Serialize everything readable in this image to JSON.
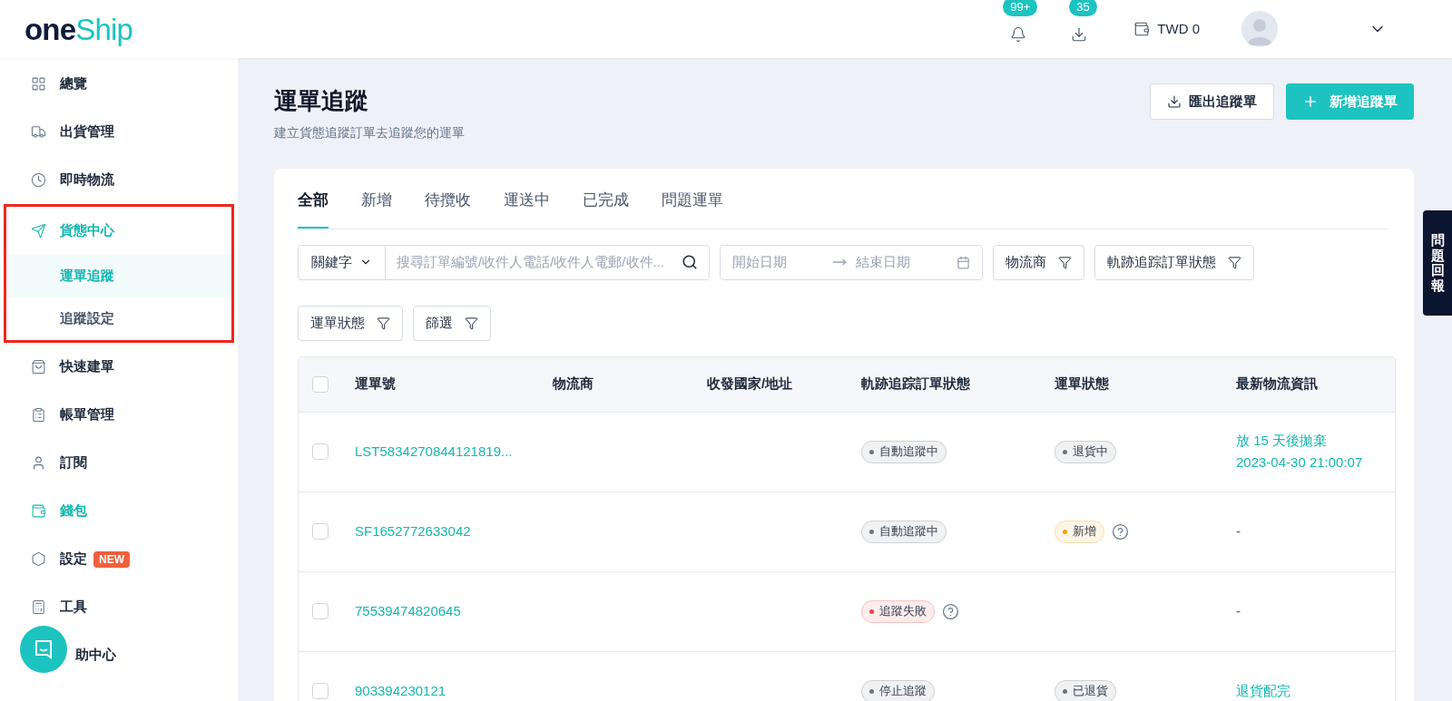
{
  "header": {
    "logo": {
      "dark": "one",
      "teal": "Ship"
    },
    "notifications": "99+",
    "downloads": "35",
    "wallet": "TWD 0"
  },
  "sidebar": {
    "items": [
      {
        "label": "總覽",
        "active": false
      },
      {
        "label": "出貨管理",
        "active": false
      },
      {
        "label": "即時物流",
        "active": false
      },
      {
        "label": "貨態中心",
        "active": true,
        "expanded": true,
        "annotated": true,
        "children": [
          {
            "label": "運單追蹤",
            "selected": true
          },
          {
            "label": "追蹤設定",
            "selected": false
          }
        ]
      },
      {
        "label": "快速建單",
        "active": false
      },
      {
        "label": "帳單管理",
        "active": false
      },
      {
        "label": "訂閱",
        "active": false
      },
      {
        "label": "錢包",
        "active": true
      },
      {
        "label": "設定",
        "active": false,
        "badge": "NEW"
      },
      {
        "label": "工具",
        "active": false
      },
      {
        "label": "助中心",
        "active": false
      }
    ]
  },
  "page": {
    "title": "運單追蹤",
    "subtitle": "建立貨態追蹤訂單去追蹤您的運單",
    "buttons": [
      {
        "label": "匯出追蹤單",
        "kind": "outline"
      },
      {
        "label": "新增追蹤單",
        "kind": "primary"
      }
    ]
  },
  "tabs": [
    {
      "label": "全部",
      "selected": true
    },
    {
      "label": "新增",
      "selected": false
    },
    {
      "label": "待攬收",
      "selected": false
    },
    {
      "label": "運送中",
      "selected": false
    },
    {
      "label": "已完成",
      "selected": false
    },
    {
      "label": "問題運單",
      "selected": false
    }
  ],
  "filters": {
    "keyword_select": "關鍵字",
    "search_placeholder": "搜尋訂單編號/收件人電話/收件人電郵/收件...",
    "start_placeholder": "開始日期",
    "end_placeholder": "結束日期",
    "buttons": [
      "物流商",
      "軌跡追踪訂單狀態",
      "運單狀態",
      "篩選"
    ]
  },
  "table": {
    "all_checked": false,
    "columns": [
      "運單號",
      "物流商",
      "收發國家/地址",
      "軌跡追踪訂單狀態",
      "運單狀態",
      "最新物流資訊"
    ],
    "rows": [
      {
        "checked": false,
        "number": "LST5834270844121819...",
        "tracking": {
          "label": "自動追蹤中",
          "color": "#6b7280",
          "help": false
        },
        "status": {
          "label": "退貨中",
          "color": "#6b7280",
          "help": false
        },
        "info": [
          "放 15 天後拋棄",
          "2023-04-30 21:00:07"
        ],
        "info_link": true
      },
      {
        "checked": false,
        "number": "SF1652772633042",
        "tracking": {
          "label": "自動追蹤中",
          "color": "#6b7280",
          "help": false
        },
        "status": {
          "label": "新增",
          "color": "#f59e0b",
          "help": true
        },
        "info": [
          "-"
        ],
        "info_link": false
      },
      {
        "checked": false,
        "number": "75539474820645",
        "tracking": {
          "label": "追蹤失敗",
          "color": "#ef4444",
          "help": true
        },
        "info": [
          "-"
        ],
        "info_link": false
      },
      {
        "checked": false,
        "number": "903394230121",
        "tracking": {
          "label": "停止追蹤",
          "color": "#6b7280",
          "help": false
        },
        "status": {
          "label": "已退貨",
          "color": "#6b7280",
          "help": false
        },
        "info": [
          "退貨配完"
        ],
        "info_link": true
      }
    ]
  },
  "feedback": "問題回報"
}
